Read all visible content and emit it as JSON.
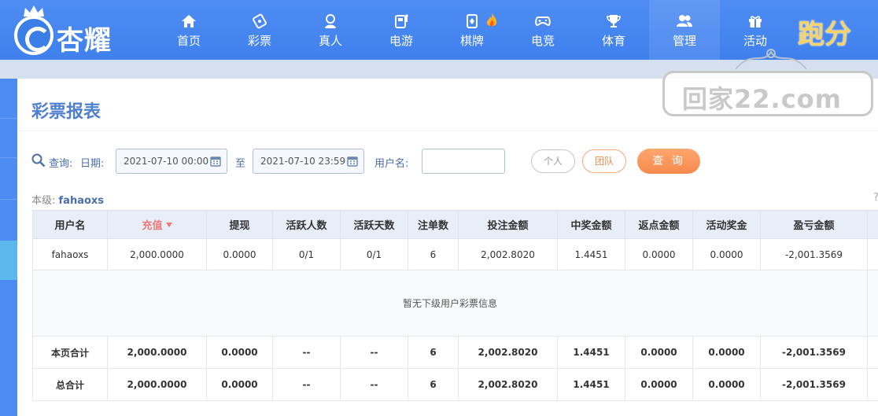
{
  "brand": {
    "logo_text": "杏耀",
    "run_text": "跑分"
  },
  "nav": [
    {
      "label": "首页",
      "icon": "home-icon"
    },
    {
      "label": "彩票",
      "icon": "lottery-icon"
    },
    {
      "label": "真人",
      "icon": "live-dealer-icon"
    },
    {
      "label": "电游",
      "icon": "slot-machine-icon"
    },
    {
      "label": "棋牌",
      "icon": "card-game-icon",
      "badge": "hot-flame-icon"
    },
    {
      "label": "电竞",
      "icon": "gamepad-icon"
    },
    {
      "label": "体育",
      "icon": "trophy-icon"
    },
    {
      "label": "管理",
      "icon": "users-icon",
      "active": true
    },
    {
      "label": "活动",
      "icon": "gift-icon"
    }
  ],
  "watermark": {
    "text": "回家22.com"
  },
  "page": {
    "title": "彩票报表"
  },
  "query": {
    "search_label": "查询:",
    "date_label": "日期:",
    "start_date": "2021-07-10 00:00",
    "to_label": "至",
    "end_date": "2021-07-10 23:59",
    "username_label": "用户名:",
    "username_value": "",
    "personal_label": "个人",
    "team_label": "团队",
    "submit_label": "查 询"
  },
  "level": {
    "label": "本级:",
    "user": "fahaoxs"
  },
  "table": {
    "headers": [
      "用户名",
      "充值",
      "提现",
      "活跃人数",
      "活跃天数",
      "注单数",
      "投注金额",
      "中奖金额",
      "返点金额",
      "活动奖金",
      "盈亏金额"
    ],
    "sorted_column": "充值",
    "row": [
      "fahaoxs",
      "2,000.0000",
      "0.0000",
      "0/1",
      "0/1",
      "6",
      "2,002.8020",
      "1.4451",
      "0.0000",
      "0.0000",
      "-2,001.3569"
    ],
    "empty_message": "暂无下级用户彩票信息",
    "page_total": [
      "本页合计",
      "2,000.0000",
      "0.0000",
      "--",
      "--",
      "6",
      "2,002.8020",
      "1.4451",
      "0.0000",
      "0.0000",
      "-2,001.3569"
    ],
    "grand_total": [
      "总合计",
      "2,000.0000",
      "0.0000",
      "--",
      "--",
      "6",
      "2,002.8020",
      "1.4451",
      "0.0000",
      "0.0000",
      "-2,001.3569"
    ]
  },
  "colors": {
    "nav_bg": "#4a88f0",
    "accent": "#4f7fcf",
    "negative": "#d7262c",
    "query_button": "#f58a4d"
  }
}
